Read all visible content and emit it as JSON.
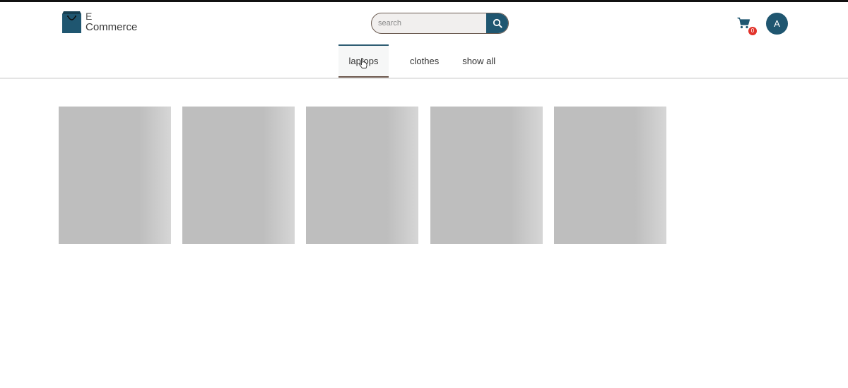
{
  "brand": {
    "line1": "E",
    "line2": "Commerce",
    "logo_icon": "shopping-bag-icon"
  },
  "search": {
    "placeholder": "search",
    "value": "",
    "button_icon": "search-icon"
  },
  "cart": {
    "icon": "cart-icon",
    "count": "0"
  },
  "user": {
    "initial": "A"
  },
  "tabs": [
    {
      "label": "laptops",
      "active": true
    },
    {
      "label": "clothes",
      "active": false
    },
    {
      "label": "show all",
      "active": false
    }
  ],
  "products": {
    "loading": true,
    "placeholder_cards": 5
  },
  "colors": {
    "primary": "#1f5670",
    "accent_brown": "#6e5a4f",
    "badge": "#e2332b",
    "skeleton": "#bebebe"
  }
}
